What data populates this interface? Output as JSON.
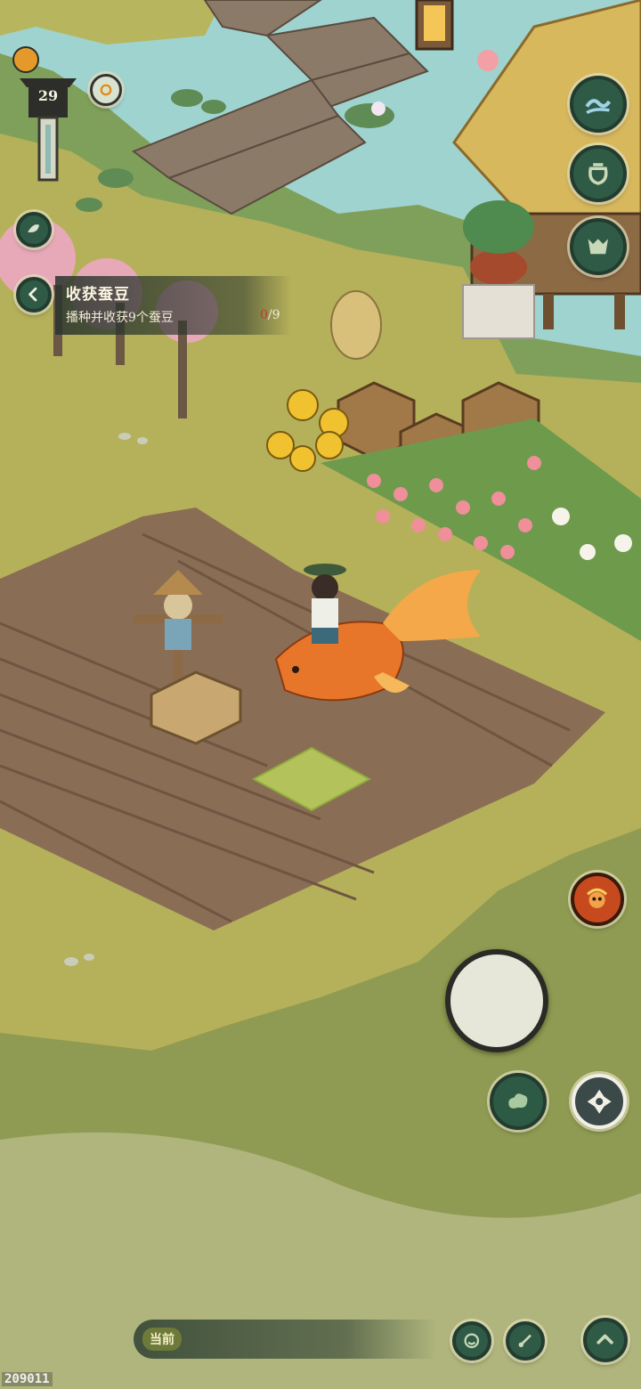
{
  "player": {
    "level": "29"
  },
  "quest": {
    "title": "收获蚕豆",
    "description": "播种并收获9个蚕豆",
    "progress_current": "0",
    "progress_total": "/9"
  },
  "chat": {
    "channel_label": "当前"
  },
  "build_id": "209011",
  "colors": {
    "button_fill": "#2f5a46",
    "button_border": "#223c30",
    "quest_panel": "#28342c",
    "progress_highlight": "#c0392b",
    "grass": "#b5b05a",
    "soil": "#8a6d55",
    "water": "#9fd3d0"
  },
  "icons": {
    "top_right_1": "water-wave-icon",
    "top_right_2": "pot-icon",
    "top_right_3": "creature-icon",
    "left_circle": "leaf-icon",
    "companion": "monkey-king-portrait-icon",
    "skill_1": "cloud-swirl-icon",
    "skill_2": "shuriken-diamond-icon",
    "bottom_1": "smile-emote-icon",
    "bottom_2": "brush-icon",
    "bottom_3": "chevron-up-icon"
  }
}
